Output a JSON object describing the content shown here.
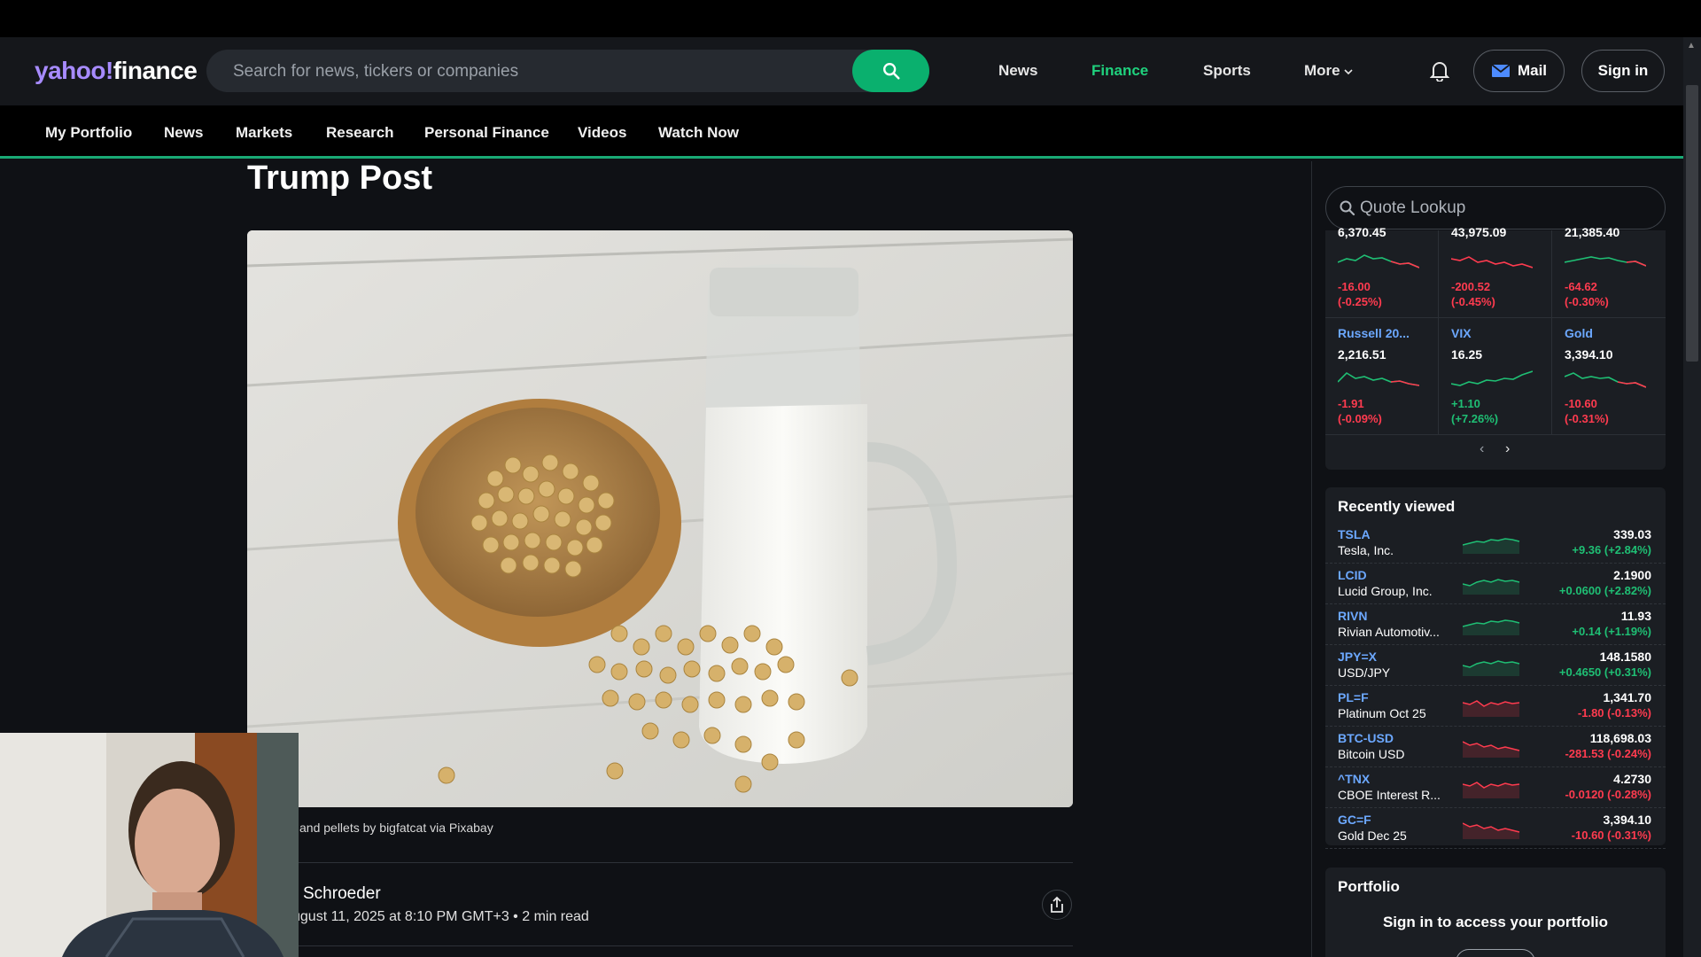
{
  "header": {
    "logo_yahoo": "yahoo!",
    "logo_finance": "finance",
    "search_placeholder": "Search for news, tickers or companies",
    "nav": [
      "News",
      "Finance",
      "Sports",
      "More"
    ],
    "mail_label": "Mail",
    "signin_label": "Sign in"
  },
  "subnav": [
    "My Portfolio",
    "News",
    "Markets",
    "Research",
    "Personal Finance",
    "Videos",
    "Watch Now"
  ],
  "article": {
    "title": "Trump Post",
    "caption": "and pellets by bigfatcat via Pixabay",
    "author": "Schroeder",
    "date": "ugust 11, 2025 at 8:10 PM GMT+3 • 2 min read"
  },
  "sidebar": {
    "quote_placeholder": "Quote Lookup",
    "markets_top": [
      {
        "value": "6,370.45",
        "change": "-16.00",
        "pct": "(-0.25%)",
        "dir": "neg"
      },
      {
        "value": "43,975.09",
        "change": "-200.52",
        "pct": "(-0.45%)",
        "dir": "neg"
      },
      {
        "value": "21,385.40",
        "change": "-64.62",
        "pct": "(-0.30%)",
        "dir": "neg"
      }
    ],
    "markets_bottom": [
      {
        "name": "Russell 20...",
        "value": "2,216.51",
        "change": "-1.91",
        "pct": "(-0.09%)",
        "dir": "neg"
      },
      {
        "name": "VIX",
        "value": "16.25",
        "change": "+1.10",
        "pct": "(+7.26%)",
        "dir": "pos"
      },
      {
        "name": "Gold",
        "value": "3,394.10",
        "change": "-10.60",
        "pct": "(-0.31%)",
        "dir": "neg"
      }
    ],
    "recently_viewed_title": "Recently viewed",
    "recently_viewed": [
      {
        "symbol": "TSLA",
        "name": "Tesla, Inc.",
        "price": "339.03",
        "change": "+9.36 (+2.84%)",
        "dir": "pos"
      },
      {
        "symbol": "LCID",
        "name": "Lucid Group, Inc.",
        "price": "2.1900",
        "change": "+0.0600 (+2.82%)",
        "dir": "pos"
      },
      {
        "symbol": "RIVN",
        "name": "Rivian Automotiv...",
        "price": "11.93",
        "change": "+0.14 (+1.19%)",
        "dir": "pos"
      },
      {
        "symbol": "JPY=X",
        "name": "USD/JPY",
        "price": "148.1580",
        "change": "+0.4650 (+0.31%)",
        "dir": "pos"
      },
      {
        "symbol": "PL=F",
        "name": "Platinum Oct 25",
        "price": "1,341.70",
        "change": "-1.80 (-0.13%)",
        "dir": "neg"
      },
      {
        "symbol": "BTC-USD",
        "name": "Bitcoin USD",
        "price": "118,698.03",
        "change": "-281.53 (-0.24%)",
        "dir": "neg"
      },
      {
        "symbol": "^TNX",
        "name": "CBOE Interest R...",
        "price": "4.2730",
        "change": "-0.0120 (-0.28%)",
        "dir": "neg"
      },
      {
        "symbol": "GC=F",
        "name": "Gold Dec 25",
        "price": "3,394.10",
        "change": "-10.60 (-0.31%)",
        "dir": "neg"
      }
    ],
    "portfolio_title": "Portfolio",
    "portfolio_message": "Sign in to access your portfolio"
  },
  "colors": {
    "accent": "#0ab06e",
    "positive": "#1fbf74",
    "negative": "#ff3b4f",
    "link": "#6ca8ff",
    "brand": "#a78bff"
  },
  "icons": [
    "search-icon",
    "bell-icon",
    "mail-icon",
    "share-icon",
    "chevron-left-icon",
    "chevron-right-icon"
  ]
}
